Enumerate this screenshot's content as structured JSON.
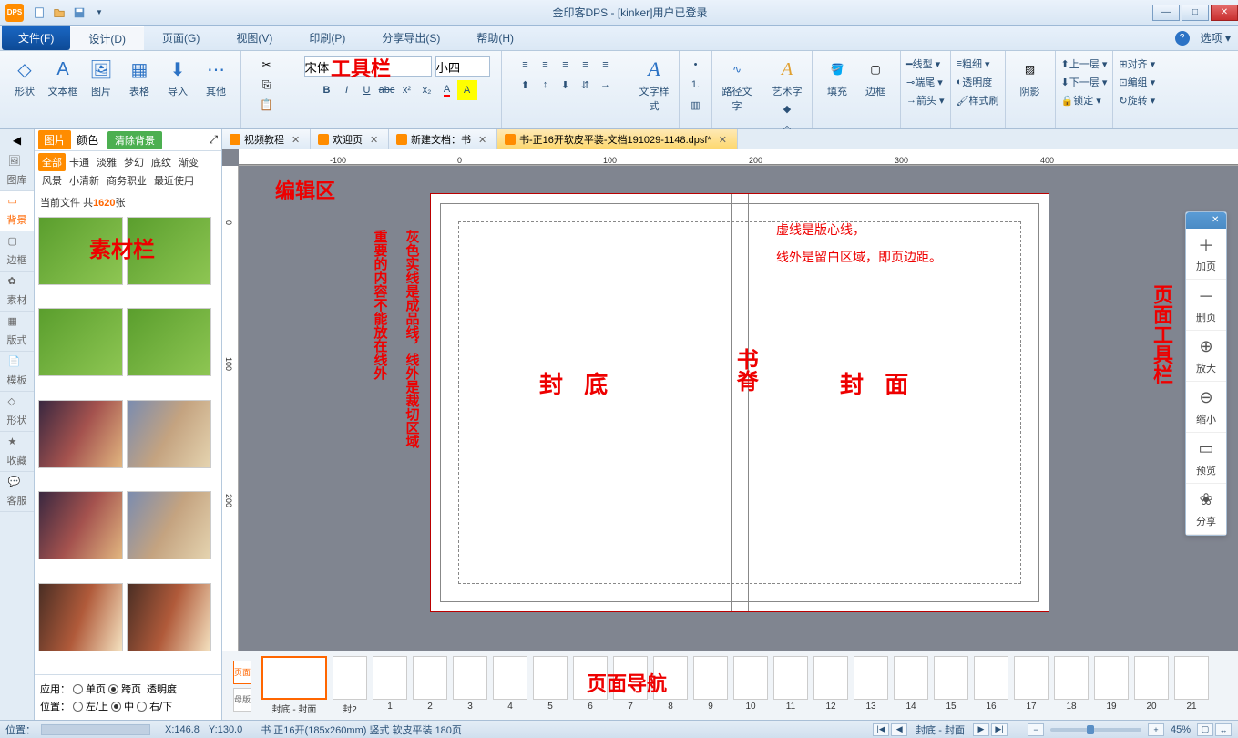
{
  "title": "金印客DPS - [kinker]用户已登录",
  "qat": [
    "new",
    "open",
    "save",
    "undo",
    "redo"
  ],
  "win": {
    "min": "—",
    "max": "□",
    "close": "✕"
  },
  "file_menu": "文件(F)",
  "menus": [
    "设计(D)",
    "页面(G)",
    "视图(V)",
    "印刷(P)",
    "分享导出(S)",
    "帮助(H)"
  ],
  "active_menu": 0,
  "options_label": "选项 ▾",
  "ribbon": {
    "insert": [
      {
        "label": "形状"
      },
      {
        "label": "文本框"
      },
      {
        "label": "图片"
      },
      {
        "label": "表格"
      },
      {
        "label": "导入"
      },
      {
        "label": "其他"
      }
    ],
    "font_name": "宋体",
    "font_size": "小四",
    "toolbar_label": "工具栏",
    "text_style": "文字样式",
    "path_text": "路径文字",
    "art_text": "艺术字",
    "fill": "填充",
    "border": "边框",
    "line_type": "线型 ▾",
    "end_pt": "端尾 ▾",
    "arrow": "箭头 ▾",
    "thick": "粗细 ▾",
    "transparent": "透明度",
    "brush": "样式刷",
    "shadow": "阴影",
    "up_layer": "上一层 ▾",
    "down_layer": "下一层 ▾",
    "lock": "锁定 ▾",
    "align": "对齐 ▾",
    "group": "编组 ▾",
    "rotate": "旋转 ▾"
  },
  "left_tabs": [
    "图库",
    "背景",
    "边框",
    "素材",
    "版式",
    "模板",
    "形状",
    "收藏",
    "客服"
  ],
  "active_left_tab": 1,
  "gallery": {
    "top_tabs": [
      "图片",
      "颜色"
    ],
    "active_top": 0,
    "clear_bg": "清除背景",
    "cats": [
      "全部",
      "卡通",
      "淡雅",
      "梦幻",
      "底纹",
      "渐变",
      "风景",
      "小清新",
      "商务职业",
      "最近使用"
    ],
    "active_cat": 0,
    "current_file": "当前文件",
    "count_prefix": "共",
    "count": "1620",
    "count_suffix": "张",
    "panel_label": "素材栏",
    "apply_label": "应用：",
    "single": "单页",
    "spread": "跨页",
    "transp": "透明度",
    "pos_label": "位置：",
    "pos_left": "左/上",
    "pos_mid": "中",
    "pos_right": "右/下"
  },
  "doc_tabs": [
    {
      "label": "视频教程",
      "active": false
    },
    {
      "label": "欢迎页",
      "active": false
    },
    {
      "label": "新建文档：书",
      "active": false
    },
    {
      "label": "书-正16开软皮平装-文档191029-1148.dpsf*",
      "active": true
    }
  ],
  "ruler_h": [
    "-100",
    "0",
    "100",
    "200",
    "300",
    "400"
  ],
  "ruler_v": [
    "0",
    "100",
    "200"
  ],
  "canvas": {
    "edit_area": "编辑区",
    "gray_line_note": "灰色实线是成品线，线外是裁切区域",
    "content_note": "重要的内容不能放在线外",
    "dash_note1": "虚线是版心线，",
    "dash_note2": "线外是留白区域，即页边距。",
    "back_cover": "封 底",
    "spine": "书脊",
    "front_cover": "封 面",
    "right_label": "页面工具栏"
  },
  "right_tools": [
    {
      "icon": "＋",
      "label": "加页"
    },
    {
      "icon": "－",
      "label": "删页"
    },
    {
      "icon": "⊕",
      "label": "放大"
    },
    {
      "icon": "⊖",
      "label": "缩小"
    },
    {
      "icon": "▭",
      "label": "预览"
    },
    {
      "icon": "❀",
      "label": "分享"
    }
  ],
  "page_nav": {
    "mode_page": "页面",
    "mode_master": "母版",
    "nav_label": "页面导航",
    "pages": [
      "封底 - 封面",
      "封2",
      "1",
      "2",
      "3",
      "4",
      "5",
      "6",
      "7",
      "8",
      "9",
      "10",
      "11",
      "12",
      "13",
      "14",
      "15",
      "16",
      "17",
      "18",
      "19",
      "20",
      "21"
    ]
  },
  "status": {
    "pos_label": "位置：",
    "x": "X:146.8",
    "y": "Y:130.0",
    "doc_info": "书 正16开(185x260mm) 竖式 软皮平装 180页",
    "current_page": "封底 - 封面",
    "zoom": "45%"
  }
}
